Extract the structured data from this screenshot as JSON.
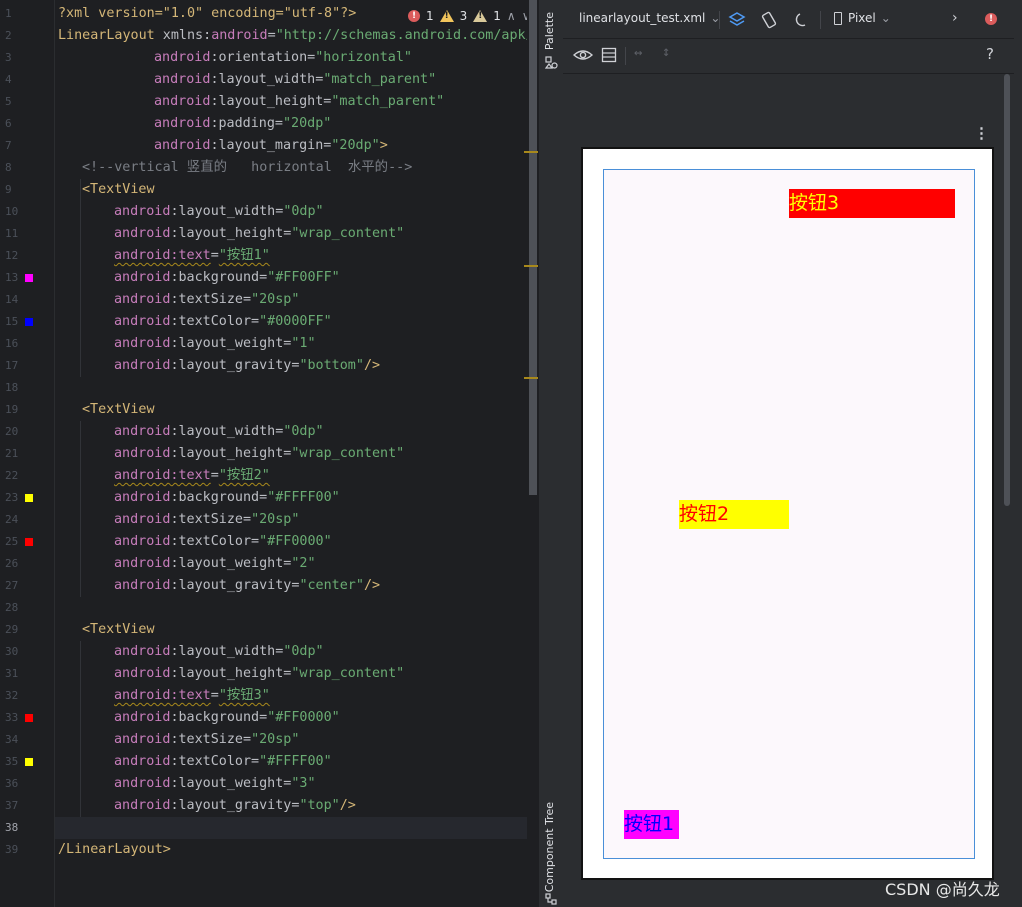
{
  "editor": {
    "line_numbers": [
      "1",
      "2",
      "3",
      "4",
      "5",
      "6",
      "7",
      "8",
      "9",
      "10",
      "11",
      "12",
      "13",
      "14",
      "15",
      "16",
      "17",
      "18",
      "19",
      "20",
      "21",
      "22",
      "23",
      "24",
      "25",
      "26",
      "27",
      "28",
      "29",
      "30",
      "31",
      "32",
      "33",
      "34",
      "35",
      "36",
      "37",
      "38",
      "39"
    ],
    "inspections": {
      "errors": "1",
      "warnings": "3",
      "weak_warnings": "1"
    },
    "lines": {
      "l1": "?xml version=\"1.0\" encoding=\"utf-8\"?>",
      "l2a": "LinearLayout",
      "l2b": " xmlns:",
      "l2c": "android",
      "l2d": "=",
      "l2e": "\"http://schemas.android.com/apk/r",
      "l3a": "android",
      "l3b": ":orientation=",
      "l3c": "\"horizontal\"",
      "l4a": "android",
      "l4b": ":layout_width=",
      "l4c": "\"match_parent\"",
      "l5a": "android",
      "l5b": ":layout_height=",
      "l5c": "\"match_parent\"",
      "l6a": "android",
      "l6b": ":padding=",
      "l6c": "\"20dp\"",
      "l7a": "android",
      "l7b": ":layout_margin=",
      "l7c": "\"20dp\"",
      "l7d": ">",
      "l8": "<!--vertical 竖直的   horizontal  水平的-->",
      "l9": "<TextView",
      "l10a": "android",
      "l10b": ":layout_width=",
      "l10c": "\"0dp\"",
      "l11a": "android",
      "l11b": ":layout_height=",
      "l11c": "\"wrap_content\"",
      "l12a": "android:text",
      "l12b": "=",
      "l12c": "\"按钮1\"",
      "l13a": "android",
      "l13b": ":background=",
      "l13c": "\"#FF00FF\"",
      "l14a": "android",
      "l14b": ":textSize=",
      "l14c": "\"20sp\"",
      "l15a": "android",
      "l15b": ":textColor=",
      "l15c": "\"#0000FF\"",
      "l16a": "android",
      "l16b": ":layout_weight=",
      "l16c": "\"1\"",
      "l17a": "android",
      "l17b": ":layout_gravity=",
      "l17c": "\"bottom\"",
      "l17d": "/>",
      "l19": "<TextView",
      "l20a": "android",
      "l20b": ":layout_width=",
      "l20c": "\"0dp\"",
      "l21a": "android",
      "l21b": ":layout_height=",
      "l21c": "\"wrap_content\"",
      "l22a": "android:text",
      "l22b": "=",
      "l22c": "\"按钮2\"",
      "l23a": "android",
      "l23b": ":background=",
      "l23c": "\"#FFFF00\"",
      "l24a": "android",
      "l24b": ":textSize=",
      "l24c": "\"20sp\"",
      "l25a": "android",
      "l25b": ":textColor=",
      "l25c": "\"#FF0000\"",
      "l26a": "android",
      "l26b": ":layout_weight=",
      "l26c": "\"2\"",
      "l27a": "android",
      "l27b": ":layout_gravity=",
      "l27c": "\"center\"",
      "l27d": "/>",
      "l29": "<TextView",
      "l30a": "android",
      "l30b": ":layout_width=",
      "l30c": "\"0dp\"",
      "l31a": "android",
      "l31b": ":layout_height=",
      "l31c": "\"wrap_content\"",
      "l32a": "android:text",
      "l32b": "=",
      "l32c": "\"按钮3\"",
      "l33a": "android",
      "l33b": ":background=",
      "l33c": "\"#FF0000\"",
      "l34a": "android",
      "l34b": ":textSize=",
      "l34c": "\"20sp\"",
      "l35a": "android",
      "l35b": ":textColor=",
      "l35c": "\"#FFFF00\"",
      "l36a": "android",
      "l36b": ":layout_weight=",
      "l36c": "\"3\"",
      "l37a": "android",
      "l37b": ":layout_gravity=",
      "l37c": "\"top\"",
      "l37d": "/>",
      "l39": "/LinearLayout>"
    },
    "gutter_colors": {
      "l13": "#FF00FF",
      "l15": "#0000FF",
      "l23": "#FFFF00",
      "l25": "#FF0000",
      "l33": "#FF0000",
      "l35": "#FFFF00"
    }
  },
  "side_strip": {
    "palette_label": "Palette",
    "component_tree_label": "Component Tree"
  },
  "design_toolbar": {
    "file_name": "linearlayout_test.xml",
    "device": "Pixel"
  },
  "preview": {
    "views": [
      {
        "text": "按钮1",
        "background": "#FF00FF",
        "text_color": "#0000FF",
        "gravity": "bottom"
      },
      {
        "text": "按钮2",
        "background": "#FFFF00",
        "text_color": "#FF0000",
        "gravity": "center"
      },
      {
        "text": "按钮3",
        "background": "#FF0000",
        "text_color": "#FFFF00",
        "gravity": "top"
      }
    ]
  },
  "watermark": "CSDN @尚久龙"
}
